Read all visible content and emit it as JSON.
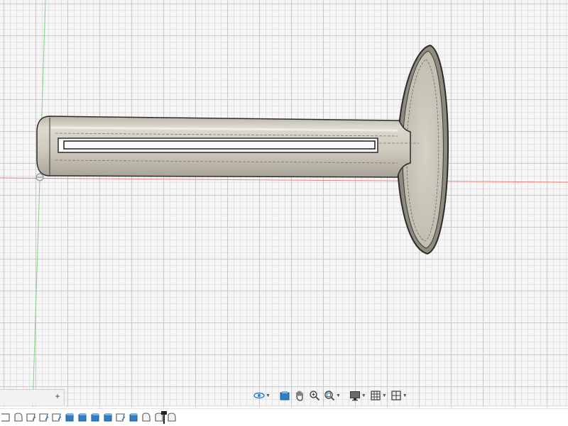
{
  "canvas": {
    "background": "#f6f6f6",
    "grid_major": "#c9c9c9",
    "grid_minor": "#e2e2e2",
    "axis_x_color": "#f08080",
    "axis_y_color": "#7ed67e",
    "body_color": "#cdc8bd",
    "body_shadow": "#a9a396",
    "edge_color": "#2b2b2b"
  },
  "browser_tab": {
    "add_label": "+"
  },
  "nav_toolbar": {
    "items": [
      {
        "icon": "orbit-icon",
        "has_dropdown": true
      },
      {
        "icon": "look-at-icon",
        "has_dropdown": false
      },
      {
        "icon": "pan-hand-icon",
        "has_dropdown": false
      },
      {
        "icon": "zoom-icon",
        "has_dropdown": false
      },
      {
        "icon": "fit-window-icon",
        "has_dropdown": true
      },
      {
        "icon": "display-settings-icon",
        "has_dropdown": true
      },
      {
        "icon": "grid-snaps-icon",
        "has_dropdown": true
      },
      {
        "icon": "viewports-icon",
        "has_dropdown": true
      }
    ]
  },
  "timeline": {
    "features": [
      "sketch",
      "extrude",
      "sketch",
      "extrude",
      "sketch",
      "body",
      "body",
      "body",
      "body",
      "sketch",
      "body",
      "extrude",
      "extrude",
      "extrude"
    ],
    "accent": "#2f7fc4"
  }
}
